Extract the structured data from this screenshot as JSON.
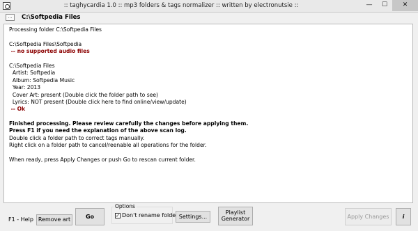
{
  "window": {
    "title": ":: taghycardia 1.0 :: mp3 folders & tags normalizer :: written by electronutsie ::",
    "minimize_glyph": "—",
    "maximize_glyph": "☐",
    "close_glyph": "✕"
  },
  "pathbar": {
    "folder_icon": "...",
    "current_path": "C:\\Softpedia Files"
  },
  "log": {
    "lines": [
      {
        "text": "Processing folder C:\\Softpedia Files",
        "style": "normal"
      },
      {
        "text": "",
        "style": "normal"
      },
      {
        "text": "C:\\Softpedia Files\\Softpedia",
        "style": "normal"
      },
      {
        "text": " -- no supported audio files",
        "style": "red"
      },
      {
        "text": "",
        "style": "normal"
      },
      {
        "text": "C:\\Softpedia Files",
        "style": "normal"
      },
      {
        "text": "  Artist: Softpedia",
        "style": "normal"
      },
      {
        "text": "  Album: Softpedia Music",
        "style": "normal"
      },
      {
        "text": "  Year: 2013",
        "style": "normal"
      },
      {
        "text": "  Cover Art: present (Double click the folder path to see)",
        "style": "normal"
      },
      {
        "text": "  Lyrics: NOT present (Double click here to find online/view/update)",
        "style": "normal"
      },
      {
        "text": " -- Ok",
        "style": "red"
      },
      {
        "text": "",
        "style": "normal"
      },
      {
        "text": "Finished processing. Please review carefully the changes before applying them.",
        "style": "bold"
      },
      {
        "text": "Press F1 if you need the explanation of the above scan log.",
        "style": "bold"
      },
      {
        "text": "Double click a folder path to correct tags manually.",
        "style": "normal"
      },
      {
        "text": "Right click on a folder path to cancel/reenable all operations for the folder.",
        "style": "normal"
      },
      {
        "text": "",
        "style": "normal"
      },
      {
        "text": "When ready, press Apply Changes or push Go to rescan current folder.",
        "style": "normal"
      }
    ]
  },
  "bottom": {
    "help_label": "F1 - Help",
    "remove_art_label": "Remove art",
    "go_label": "Go",
    "options_legend": "Options",
    "dont_rename_label": "Don't rename folders",
    "dont_rename_checked": true,
    "settings_label": "Settings...",
    "playlist_line1": "Playlist",
    "playlist_line2": "Generator",
    "apply_label": "Apply Changes",
    "info_label": "i"
  },
  "colors": {
    "log_highlight_red": "#8b0000",
    "window_background": "#f0f0f0"
  }
}
